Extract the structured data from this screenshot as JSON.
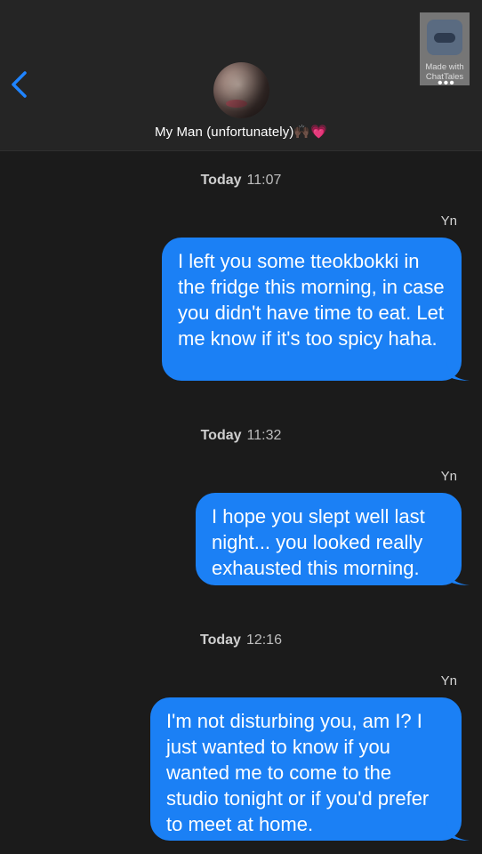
{
  "header": {
    "contact_name": "My Man (unfortunately)🙌🏿💗",
    "more_dots": "•••",
    "watermark": {
      "line1": "Made with",
      "line2": "ChatTales"
    }
  },
  "colors": {
    "background": "#1b1b1b",
    "header_background": "#252525",
    "bubble_blue": "#1b80f5",
    "back_blue": "#1f84ff"
  },
  "icons": {
    "back": "chevron-left-icon",
    "more": "more-dots-icon",
    "logo": "chattales-logo"
  },
  "messages": [
    {
      "day": "Today",
      "time": "11:07",
      "sender": "Yn",
      "text": "I left you some tteokbokki in the fridge this morning, in case you didn't have time to eat. Let me know if it's too spicy haha."
    },
    {
      "day": "Today",
      "time": "11:32",
      "sender": "Yn",
      "text": "I hope you slept well last night... you looked really exhausted this morning."
    },
    {
      "day": "Today",
      "time": "12:16",
      "sender": "Yn",
      "text": "I'm not disturbing you, am I? I just wanted to know if you wanted me to come to the studio tonight or if you'd prefer to meet at home."
    }
  ]
}
